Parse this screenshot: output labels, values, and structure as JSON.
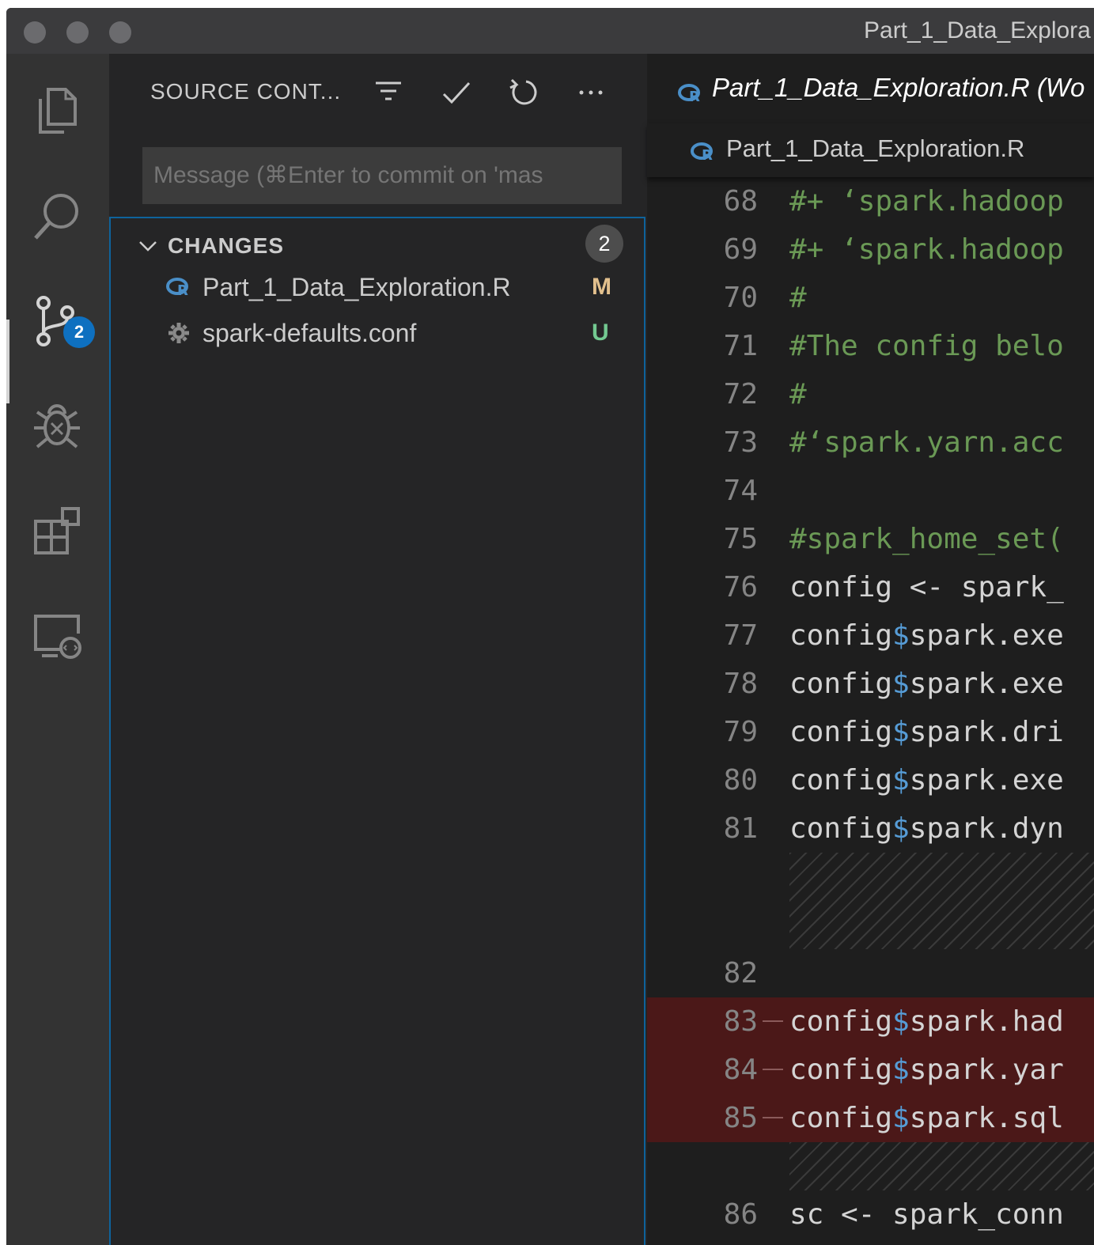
{
  "window": {
    "title": "Part_1_Data_Explora"
  },
  "activity_bar": {
    "items": [
      {
        "name": "explorer",
        "icon": "files-icon"
      },
      {
        "name": "search",
        "icon": "search-icon"
      },
      {
        "name": "source-control",
        "icon": "source-control-icon",
        "badge": "2"
      },
      {
        "name": "run-debug",
        "icon": "debug-icon"
      },
      {
        "name": "extensions",
        "icon": "extensions-icon"
      },
      {
        "name": "remote-explorer",
        "icon": "remote-explorer-icon"
      }
    ]
  },
  "sidebar": {
    "header": "SOURCE CONT...",
    "commit_message": {
      "placeholder": "Message (⌘Enter to commit on 'mas",
      "value": ""
    },
    "changes": {
      "label": "CHANGES",
      "count": "2",
      "files": [
        {
          "name": "Part_1_Data_Exploration.R",
          "status": "M",
          "status_color": "#e2c08d",
          "icon": "r-file-icon"
        },
        {
          "name": "spark-defaults.conf",
          "status": "U",
          "status_color": "#73c991",
          "icon": "gear-file-icon"
        }
      ]
    }
  },
  "editor": {
    "tab_title": "Part_1_Data_Exploration.R (Wo",
    "breadcrumb": "Part_1_Data_Exploration.R",
    "lines": [
      {
        "num": "68",
        "parts": [
          {
            "t": "#+ ‘spark.hadoop",
            "c": "cm"
          }
        ]
      },
      {
        "num": "69",
        "parts": [
          {
            "t": "#+ ‘spark.hadoop",
            "c": "cm"
          }
        ]
      },
      {
        "num": "70",
        "parts": [
          {
            "t": "#",
            "c": "cm"
          }
        ]
      },
      {
        "num": "71",
        "parts": [
          {
            "t": "#The config belo",
            "c": "cm"
          }
        ]
      },
      {
        "num": "72",
        "parts": [
          {
            "t": "#",
            "c": "cm"
          }
        ]
      },
      {
        "num": "73",
        "parts": [
          {
            "t": "#‘spark.yarn.acc",
            "c": "cm"
          }
        ]
      },
      {
        "num": "74",
        "parts": []
      },
      {
        "num": "75",
        "parts": [
          {
            "t": "#spark_home_set(",
            "c": "cm"
          }
        ]
      },
      {
        "num": "76",
        "parts": [
          {
            "t": "config <- spark_",
            "c": ""
          }
        ]
      },
      {
        "num": "77",
        "parts": [
          {
            "t": "config",
            "c": ""
          },
          {
            "t": "$",
            "c": "dl"
          },
          {
            "t": "spark.exe",
            "c": ""
          }
        ]
      },
      {
        "num": "78",
        "parts": [
          {
            "t": "config",
            "c": ""
          },
          {
            "t": "$",
            "c": "dl"
          },
          {
            "t": "spark.exe",
            "c": ""
          }
        ]
      },
      {
        "num": "79",
        "parts": [
          {
            "t": "config",
            "c": ""
          },
          {
            "t": "$",
            "c": "dl"
          },
          {
            "t": "spark.dri",
            "c": ""
          }
        ]
      },
      {
        "num": "80",
        "parts": [
          {
            "t": "config",
            "c": ""
          },
          {
            "t": "$",
            "c": "dl"
          },
          {
            "t": "spark.exe",
            "c": ""
          }
        ]
      },
      {
        "num": "81",
        "parts": [
          {
            "t": "config",
            "c": ""
          },
          {
            "t": "$",
            "c": "dl"
          },
          {
            "t": "spark.dyn",
            "c": ""
          }
        ]
      },
      {
        "num": "",
        "hatch": 2
      },
      {
        "num": "82",
        "parts": []
      },
      {
        "num": "83",
        "deleted": true,
        "parts": [
          {
            "t": "config",
            "c": ""
          },
          {
            "t": "$",
            "c": "dl"
          },
          {
            "t": "spark.had",
            "c": ""
          }
        ]
      },
      {
        "num": "84",
        "deleted": true,
        "parts": [
          {
            "t": "config",
            "c": ""
          },
          {
            "t": "$",
            "c": "dl"
          },
          {
            "t": "spark.yar",
            "c": ""
          }
        ]
      },
      {
        "num": "85",
        "deleted": true,
        "parts": [
          {
            "t": "config",
            "c": ""
          },
          {
            "t": "$",
            "c": "dl"
          },
          {
            "t": "spark.sql",
            "c": ""
          }
        ]
      },
      {
        "num": "",
        "hatch": 1
      },
      {
        "num": "86",
        "parts": [
          {
            "t": "sc <- spark_conn",
            "c": ""
          }
        ]
      }
    ]
  },
  "colors": {
    "accent": "#0e70c0",
    "deleted_bg": "#4b1818",
    "comment": "#6a9955",
    "dollar": "#569cd6"
  }
}
